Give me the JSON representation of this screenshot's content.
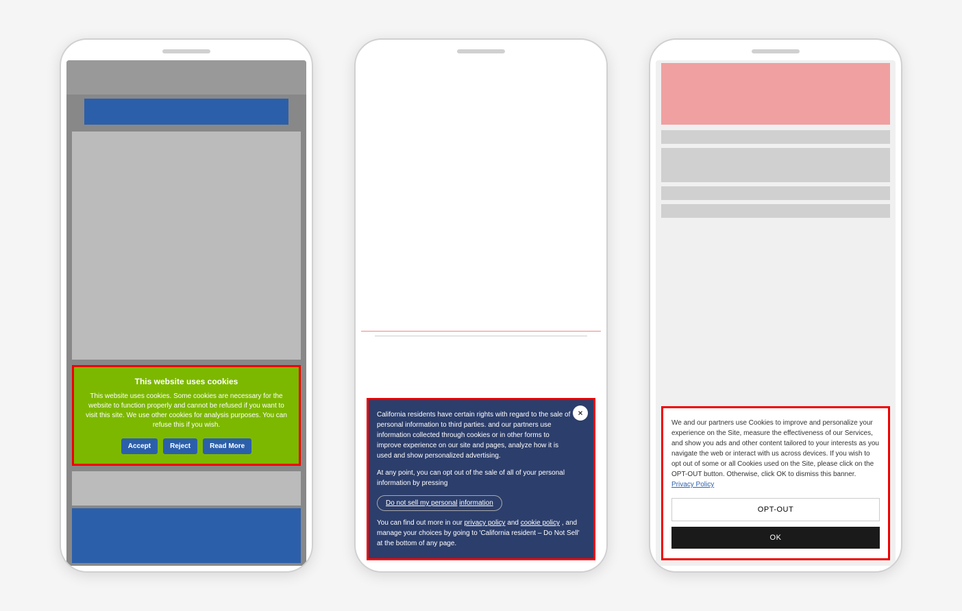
{
  "page": {
    "background": "#f5f5f5"
  },
  "phone1": {
    "cookie": {
      "title": "This website uses cookies",
      "text": "This website uses cookies. Some cookies are necessary for the website to function properly and cannot be refused if you want to visit this site. We use other cookies for analysis purposes. You can refuse this if you wish.",
      "accept_label": "Accept",
      "reject_label": "Reject",
      "read_more_label": "Read More"
    }
  },
  "phone2": {
    "close_label": "×",
    "banner_text1": "California residents have certain rights with regard to the sale of personal information to third parties.",
    "banner_text2": "and our partners use information collected through cookies or in other forms to improve experience on our site and pages, analyze how it is used and show personalized advertising.",
    "opt_out_label": "Do not sell my personal",
    "opt_out_label2": "information",
    "footer_text1": "At any point, you can opt out of the sale of all of your personal information by pressing",
    "footer_text2": "You can find out more in our",
    "privacy_policy_label": "privacy policy",
    "and_label": "and",
    "cookie_policy_label": "cookie policy",
    "footer_text3": ", and manage your choices by going to 'California resident – Do Not Sell' at the bottom of any page."
  },
  "phone3": {
    "cookie_text": "We and our partners use Cookies to improve and personalize your experience on the Site, measure the effectiveness of our Services, and show you ads and other content tailored to your interests as you navigate the web or interact with us across devices. If you wish to opt out of some or all Cookies used on the Site, please click on the OPT-OUT button. Otherwise, click OK to dismiss this banner.",
    "privacy_policy_label": "Privacy Policy",
    "opt_out_label": "OPT-OUT",
    "ok_label": "OK"
  }
}
